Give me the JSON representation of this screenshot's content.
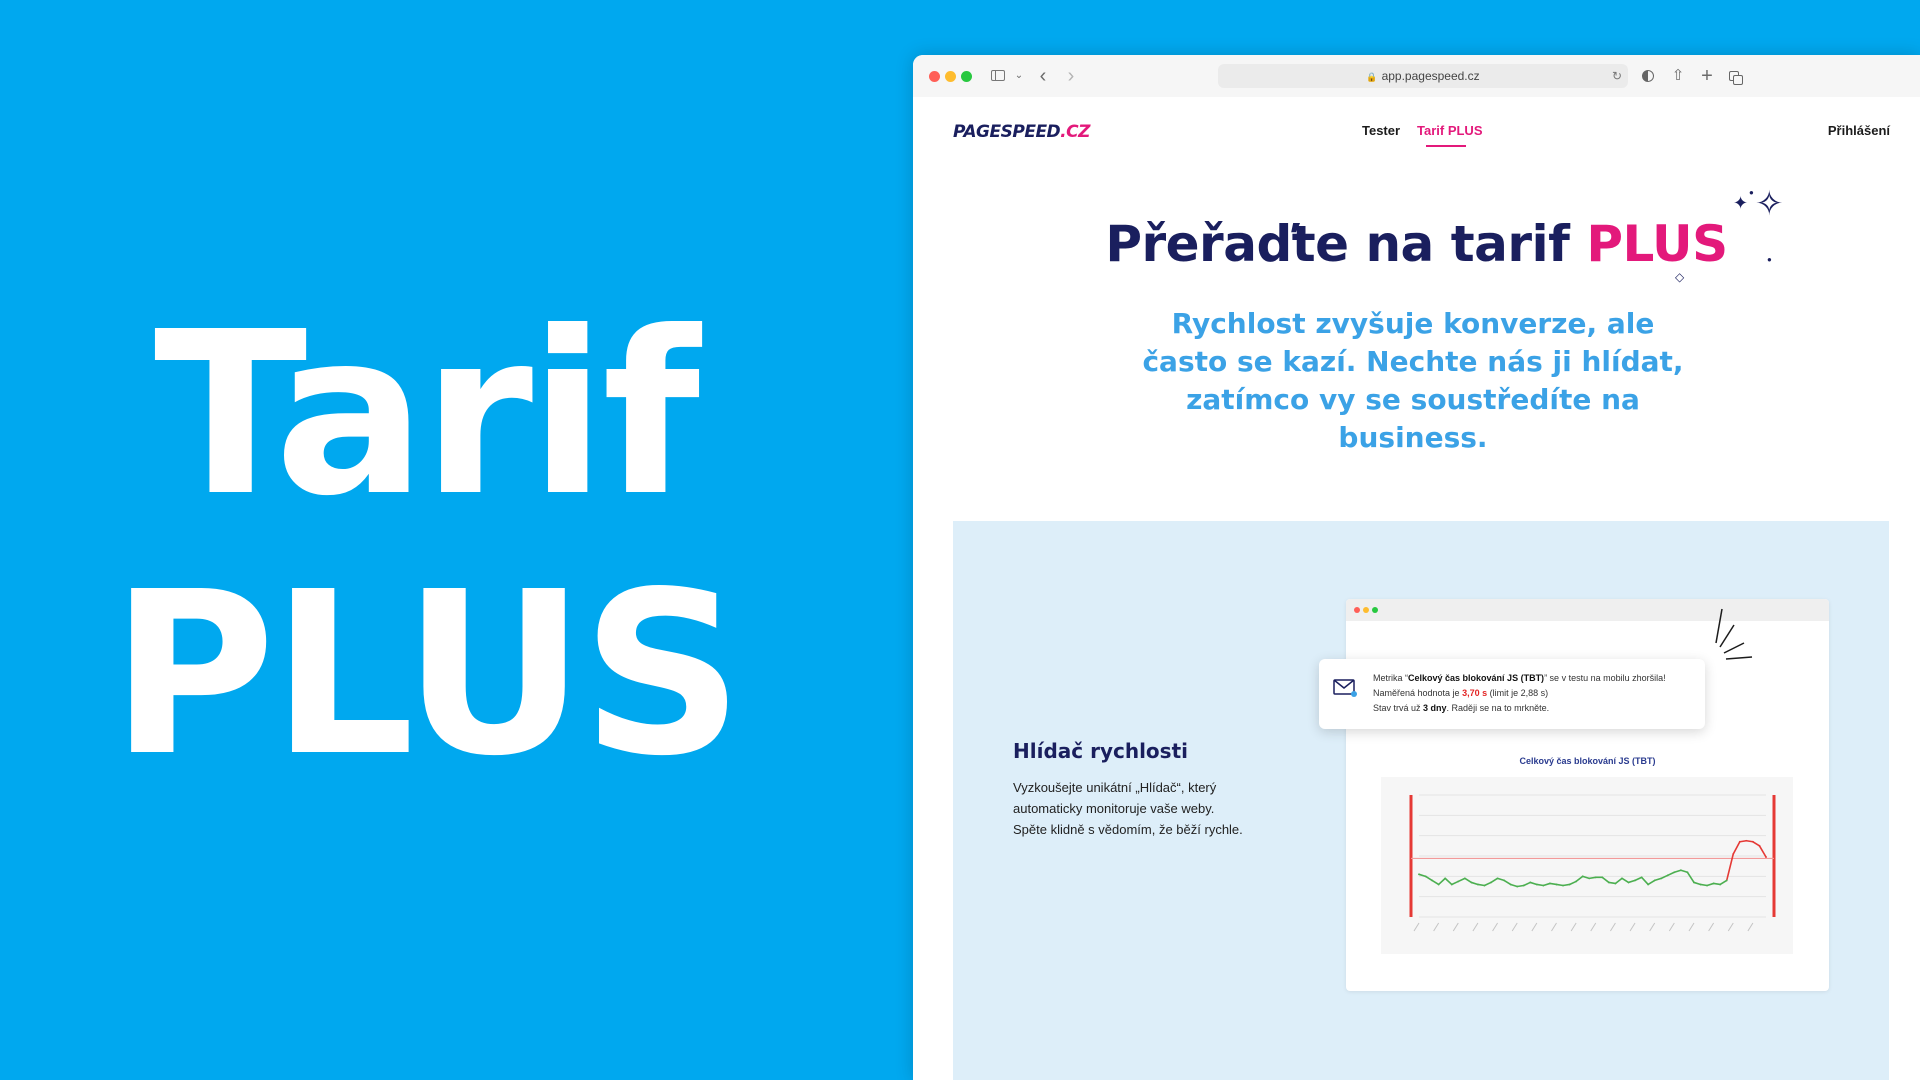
{
  "banner": {
    "line1": "Tarif",
    "line2": "PLUS"
  },
  "browser": {
    "url": "app.pagespeed.cz"
  },
  "navbar": {
    "logo_main": "PAGESPEED",
    "logo_tld": ".CZ",
    "links": [
      {
        "label": "Tester",
        "active": false
      },
      {
        "label": "Tarif PLUS",
        "active": true
      }
    ],
    "login_label": "Přihlášení"
  },
  "hero": {
    "title_prefix": "Přeřaďte na tarif",
    "title_highlight": "PLUS",
    "subtitle": "Rychlost zvyšuje konverze, ale často se kazí. Nechte nás ji hlídat, zatímco vy se soustředíte na business."
  },
  "feature": {
    "title": "Hlídač rychlosti",
    "description": "Vyzkoušejte unikátní „Hlídač“, který automaticky monitoruje vaše weby. Spěte klidně s vědomím, že běží rychle.",
    "notification": {
      "line1_prefix": "Metrika “",
      "metric": "Celkový čas blokování JS (TBT)",
      "line1_suffix": "” se v testu na mobilu zhoršila!",
      "line2_prefix": "Naměřená hodnota je ",
      "value": "3,70 s",
      "line2_suffix": " (limit je 2,88 s)",
      "line3_prefix": "Stav trvá už ",
      "duration": "3 dny",
      "line3_suffix": ". Raději se na to mrkněte."
    },
    "chart_title": "Celkový čas blokování JS (TBT)"
  },
  "colors": {
    "page_background": "#00a8ef",
    "brand_navy": "#1a1f5e",
    "brand_pink": "#e3197b",
    "subtitle_blue": "#3ba2e6",
    "feature_background": "#ddeef9",
    "series_good": "#4caf50",
    "series_bad": "#e53935",
    "limit_line": "#f29a9a"
  },
  "chart_data": {
    "type": "line",
    "title": "Celkový čas blokování JS (TBT)",
    "xlabel": "",
    "ylabel": "",
    "y_unit": "s",
    "limit": 2.88,
    "ylim": [
      0,
      6
    ],
    "values": [
      2.1,
      2.0,
      1.8,
      1.6,
      1.9,
      1.6,
      1.75,
      1.9,
      1.7,
      1.6,
      1.55,
      1.7,
      1.9,
      1.8,
      1.6,
      1.5,
      1.55,
      1.7,
      1.6,
      1.55,
      1.65,
      1.6,
      1.55,
      1.6,
      1.75,
      2.0,
      1.9,
      1.95,
      1.95,
      1.7,
      1.65,
      1.9,
      1.7,
      1.8,
      1.95,
      1.6,
      1.8,
      1.9,
      2.05,
      2.2,
      2.3,
      2.2,
      1.7,
      1.6,
      1.55,
      1.65,
      1.6,
      1.8,
      3.1,
      3.7,
      3.75,
      3.7,
      3.5,
      2.95
    ],
    "series_good_color": "#4caf50",
    "series_bad_color": "#e53935"
  }
}
